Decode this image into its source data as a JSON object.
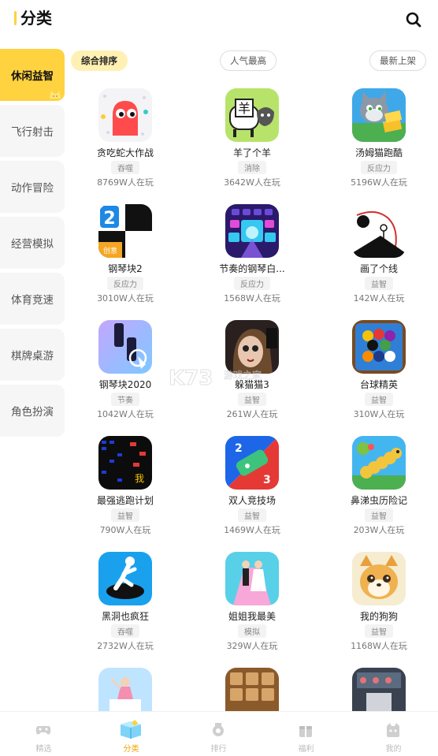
{
  "header": {
    "title": "分类",
    "search_icon": "search-icon"
  },
  "sidebar": {
    "items": [
      {
        "label": "休闲益智",
        "active": true
      },
      {
        "label": "飞行射击"
      },
      {
        "label": "动作冒险"
      },
      {
        "label": "经营模拟"
      },
      {
        "label": "体育竞速"
      },
      {
        "label": "棋牌桌游"
      },
      {
        "label": "角色扮演"
      }
    ]
  },
  "sort": {
    "options": [
      {
        "label": "综合排序",
        "active": true
      },
      {
        "label": "人气最高"
      },
      {
        "label": "最新上架"
      }
    ]
  },
  "games": [
    {
      "name": "贪吃蛇大作战",
      "tag": "吞噬",
      "plays": "8769W人在玩",
      "icon": "snake-game-icon"
    },
    {
      "name": "羊了个羊",
      "tag": "消除",
      "plays": "3642W人在玩",
      "icon": "sheep-game-icon"
    },
    {
      "name": "汤姆猫跑酷",
      "tag": "反应力",
      "plays": "5196W人在玩",
      "icon": "tom-cat-icon"
    },
    {
      "name": "钢琴块2",
      "tag": "反应力",
      "plays": "3010W人在玩",
      "icon": "piano-tiles-icon"
    },
    {
      "name": "节奏的钢琴白...",
      "tag": "反应力",
      "plays": "1568W人在玩",
      "icon": "rhythm-piano-icon"
    },
    {
      "name": "画了个线",
      "tag": "益智",
      "plays": "142W人在玩",
      "icon": "draw-line-icon"
    },
    {
      "name": "钢琴块2020",
      "tag": "节奏",
      "plays": "1042W人在玩",
      "icon": "piano-2020-icon"
    },
    {
      "name": "躲猫猫3",
      "tag": "益智",
      "plays": "261W人在玩",
      "icon": "hide-seek-icon"
    },
    {
      "name": "台球精英",
      "tag": "益智",
      "plays": "310W人在玩",
      "icon": "billiards-icon"
    },
    {
      "name": "最强逃跑计划",
      "tag": "益智",
      "plays": "790W人在玩",
      "icon": "escape-plan-icon"
    },
    {
      "name": "双人竞技场",
      "tag": "益智",
      "plays": "1469W人在玩",
      "icon": "two-player-icon"
    },
    {
      "name": "鼻涕虫历险记",
      "tag": "益智",
      "plays": "203W人在玩",
      "icon": "slug-game-icon"
    },
    {
      "name": "黑洞也疯狂",
      "tag": "吞噬",
      "plays": "2732W人在玩",
      "icon": "black-hole-icon"
    },
    {
      "name": "姐姐我最美",
      "tag": "模拟",
      "plays": "329W人在玩",
      "icon": "runway-girl-icon"
    },
    {
      "name": "我的狗狗",
      "tag": "益智",
      "plays": "1168W人在玩",
      "icon": "dog-game-icon"
    },
    {
      "name": "",
      "tag": "",
      "plays": "",
      "icon": "jump-girl-icon"
    },
    {
      "name": "",
      "tag": "",
      "plays": "",
      "icon": "number-puzzle-icon"
    },
    {
      "name": "",
      "tag": "",
      "plays": "",
      "icon": "room-game-icon"
    }
  ],
  "watermark": {
    "main": "K73",
    "sub": "游戏之家"
  },
  "bottom_nav": [
    {
      "label": "精选",
      "icon": "gamepad-icon"
    },
    {
      "label": "分类",
      "icon": "category-box-icon",
      "active": true
    },
    {
      "label": "排行",
      "icon": "medal-icon"
    },
    {
      "label": "福利",
      "icon": "gift-icon"
    },
    {
      "label": "我的",
      "icon": "profile-icon"
    }
  ],
  "colors": {
    "accent": "#ffd23f",
    "sort_active_bg": "#fff0b3",
    "nav_active": "#f0a500"
  }
}
